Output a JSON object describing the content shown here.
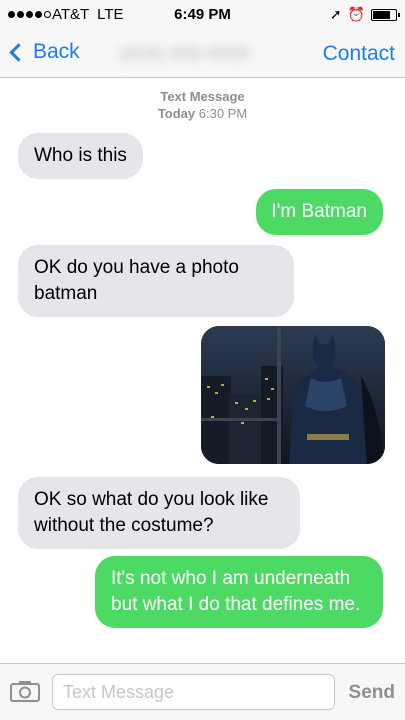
{
  "status_bar": {
    "carrier": "AT&T",
    "network": "LTE",
    "time": "6:49 PM",
    "signal_bars_filled": 4,
    "signal_bars_total": 5,
    "battery_level": 0.7
  },
  "nav": {
    "back_label": "Back",
    "contact_number": "(615) 555-5555",
    "contact_label": "Contact"
  },
  "thread": {
    "header_line1": "Text Message",
    "header_day": "Today",
    "header_time": "6:30 PM",
    "messages": [
      {
        "direction": "incoming",
        "text": "Who is this"
      },
      {
        "direction": "outgoing",
        "text": "I'm Batman"
      },
      {
        "direction": "incoming",
        "text": "OK do you have a photo batman"
      },
      {
        "direction": "outgoing",
        "type": "photo"
      },
      {
        "direction": "incoming",
        "text": "OK so what do you look like without the costume?"
      },
      {
        "direction": "outgoing",
        "text": "It's not who I am underneath but what I do that defines me."
      }
    ]
  },
  "input": {
    "placeholder": "Text Message",
    "value": "",
    "send_label": "Send"
  },
  "colors": {
    "accent": "#1e7cf2",
    "incoming_bubble": "#e5e5ea",
    "outgoing_bubble": "#4cd964"
  }
}
